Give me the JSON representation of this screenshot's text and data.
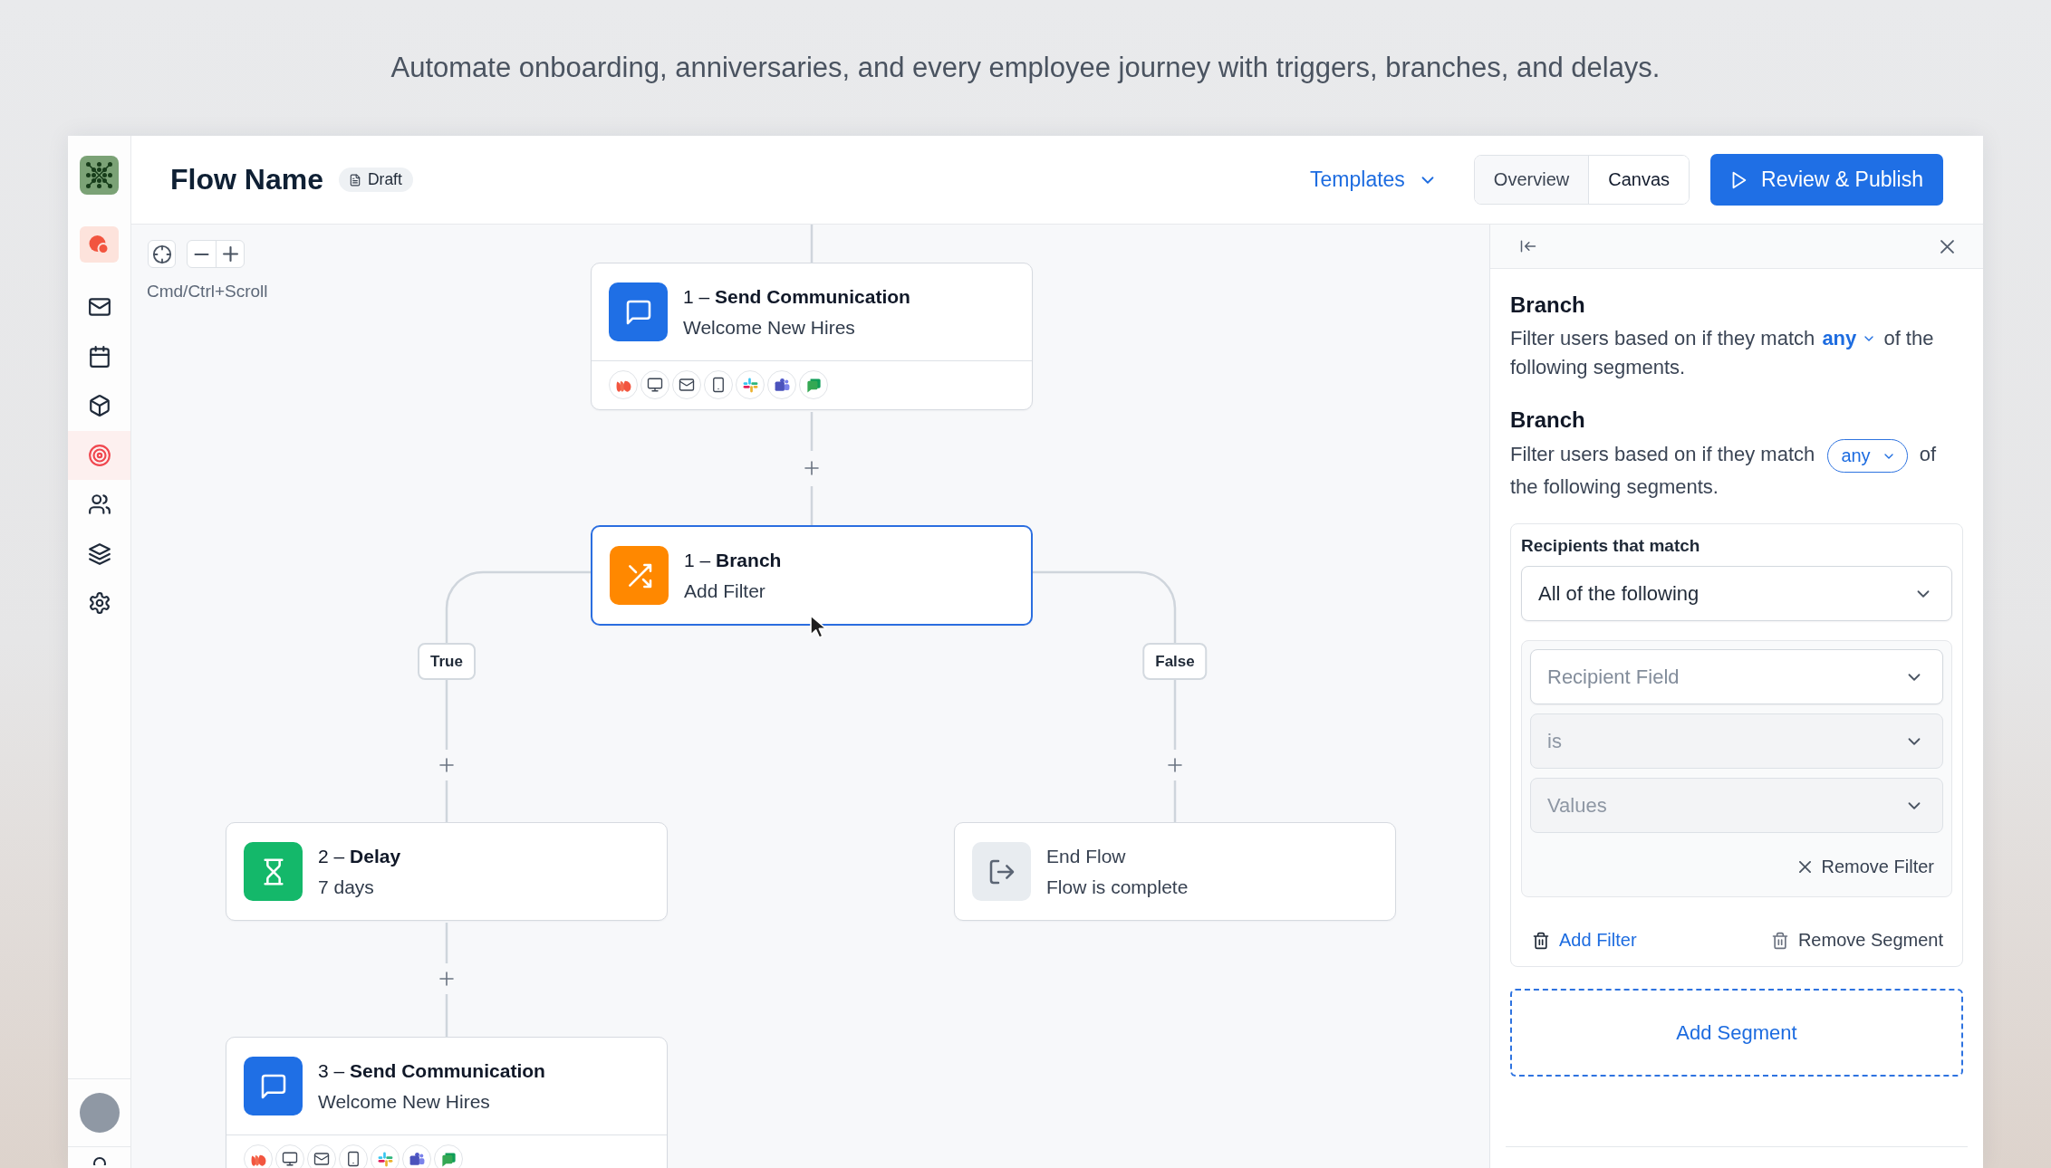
{
  "tagline": "Automate onboarding, anniversaries, and every employee journey with triggers, branches, and delays.",
  "header": {
    "title": "Flow Name",
    "status": "Draft",
    "templates": "Templates",
    "view_tabs": [
      {
        "label": "Overview",
        "selected": false
      },
      {
        "label": "Canvas",
        "selected": true
      }
    ],
    "publish": "Review & Publish"
  },
  "sidebar": {
    "items": [
      {
        "selected": false
      },
      {
        "selected": false
      },
      {
        "selected": false
      },
      {
        "selected": true
      },
      {
        "selected": false
      },
      {
        "selected": false
      },
      {
        "selected": false
      }
    ]
  },
  "canvas": {
    "hint": "Cmd/Ctrl+Scroll",
    "nodes": [
      {
        "kind": "communication",
        "heading": "1 – **Send Communication**",
        "subtitle": "Welcome New Hires",
        "selected": false
      },
      {
        "kind": "branch",
        "heading": "1 – **Branch**",
        "subtitle": "Add Filter",
        "selected": true
      },
      {
        "kind": "delay",
        "heading": "2 – **Delay**",
        "subtitle": "7 days",
        "selected": false
      },
      {
        "kind": "end",
        "heading": "End Flow",
        "subtitle": "Flow is complete",
        "selected": false
      },
      {
        "kind": "communication",
        "heading": "3 – **Send Communication**",
        "subtitle": "Welcome New Hires",
        "selected": false
      }
    ],
    "branch_labels": [
      "True",
      "False"
    ]
  },
  "panel": {
    "sections": [
      {
        "kind": "link",
        "title": "Branch",
        "text": "Filter users based on if they match",
        "match": "any",
        "text_end": "of the following segments."
      },
      {
        "kind": "pill",
        "title": "Branch",
        "text": "Filter users based on if they match",
        "match": "any",
        "text_end": "of the following segments."
      }
    ],
    "segment": {
      "label": "Recipients that match",
      "match": "All of the following",
      "filters": [
        {
          "fields": [
            {
              "placeholder": "Recipient Field",
              "disabled": false
            },
            {
              "placeholder": "is",
              "disabled": true
            },
            {
              "placeholder": "Values",
              "disabled": true
            }
          ],
          "remove": "Remove Filter"
        }
      ],
      "add_filter": "Add Filter",
      "remove_segment": "Remove Segment"
    },
    "add_segment": "Add Segment"
  }
}
